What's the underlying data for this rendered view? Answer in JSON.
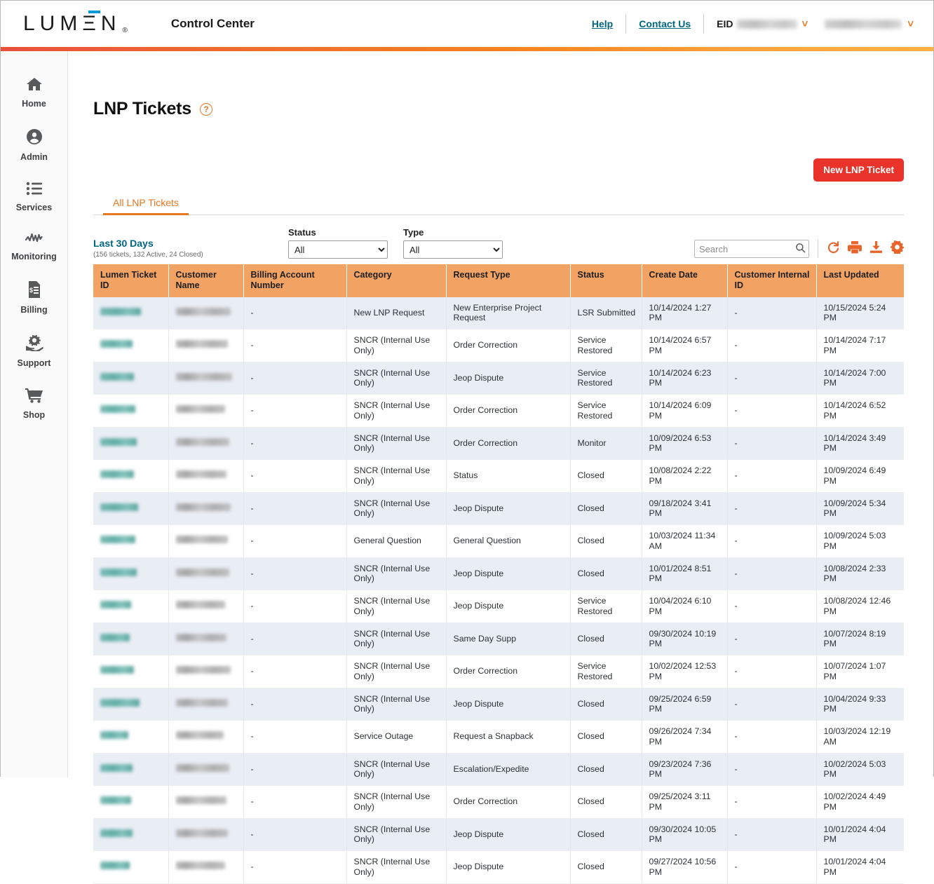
{
  "header": {
    "logo_text": "LUMΞN",
    "logo_registered": "®",
    "app_title": "Control Center",
    "help_label": "Help",
    "contact_label": "Contact Us",
    "eid_label": "EID",
    "eid_value_redacted": "",
    "account_value_redacted": "",
    "accent_color_left": "#e8503c",
    "accent_color_right": "#fbb040"
  },
  "sidebar": {
    "items": [
      {
        "label": "Home",
        "icon": "home-icon"
      },
      {
        "label": "Admin",
        "icon": "user-circle-icon"
      },
      {
        "label": "Services",
        "icon": "list-icon"
      },
      {
        "label": "Monitoring",
        "icon": "waveform-icon"
      },
      {
        "label": "Billing",
        "icon": "invoice-dollar-icon"
      },
      {
        "label": "Support",
        "icon": "hand-gear-icon"
      },
      {
        "label": "Shop",
        "icon": "shopping-cart-icon"
      }
    ]
  },
  "page": {
    "title": "LNP Tickets",
    "help_icon_glyph": "?",
    "new_ticket_button": "New LNP Ticket",
    "accent_orange": "#e87722",
    "button_red": "#e8322a"
  },
  "tabs": [
    {
      "label": "All LNP Tickets",
      "active": true
    }
  ],
  "filters": {
    "date_range_label": "Last 30 Days",
    "date_range_summary": "(156 tickets, 132 Active, 24 Closed)",
    "status": {
      "label": "Status",
      "value": "All",
      "options": [
        "All"
      ]
    },
    "type": {
      "label": "Type",
      "value": "All",
      "options": [
        "All"
      ]
    }
  },
  "search": {
    "placeholder": "Search",
    "value": "",
    "icon": "search-icon"
  },
  "toolbar_icons": [
    {
      "name": "refresh-icon"
    },
    {
      "name": "print-icon"
    },
    {
      "name": "download-icon"
    },
    {
      "name": "settings-gear-icon"
    }
  ],
  "table": {
    "columns": [
      "Lumen Ticket ID",
      "Customer Name",
      "Billing Account Number",
      "Category",
      "Request Type",
      "Status",
      "Create Date",
      "Customer Internal ID",
      "Last Updated"
    ],
    "rows": [
      {
        "ticket_id": "",
        "customer_name": "",
        "billing_account": "-",
        "category": "New LNP Request",
        "request_type": "New Enterprise Project Request",
        "status": "LSR Submitted",
        "create_date": "10/14/2024 1:27 PM",
        "internal_id": "-",
        "last_updated": "10/15/2024 5:24 PM"
      },
      {
        "ticket_id": "",
        "customer_name": "",
        "billing_account": "-",
        "category": "SNCR (Internal Use Only)",
        "request_type": "Order Correction",
        "status": "Service Restored",
        "create_date": "10/14/2024 6:57 PM",
        "internal_id": "-",
        "last_updated": "10/14/2024 7:17 PM"
      },
      {
        "ticket_id": "",
        "customer_name": "",
        "billing_account": "-",
        "category": "SNCR (Internal Use Only)",
        "request_type": "Jeop Dispute",
        "status": "Service Restored",
        "create_date": "10/14/2024 6:23 PM",
        "internal_id": "-",
        "last_updated": "10/14/2024 7:00 PM"
      },
      {
        "ticket_id": "",
        "customer_name": "",
        "billing_account": "-",
        "category": "SNCR (Internal Use Only)",
        "request_type": "Order Correction",
        "status": "Service Restored",
        "create_date": "10/14/2024 6:09 PM",
        "internal_id": "-",
        "last_updated": "10/14/2024 6:52 PM"
      },
      {
        "ticket_id": "",
        "customer_name": "",
        "billing_account": "-",
        "category": "SNCR (Internal Use Only)",
        "request_type": "Order Correction",
        "status": "Monitor",
        "create_date": "10/09/2024 6:53 PM",
        "internal_id": "-",
        "last_updated": "10/14/2024 3:49 PM"
      },
      {
        "ticket_id": "",
        "customer_name": "",
        "billing_account": "-",
        "category": "SNCR (Internal Use Only)",
        "request_type": "Status",
        "status": "Closed",
        "create_date": "10/08/2024 2:22 PM",
        "internal_id": "-",
        "last_updated": "10/09/2024 6:49 PM"
      },
      {
        "ticket_id": "",
        "customer_name": "",
        "billing_account": "-",
        "category": "SNCR (Internal Use Only)",
        "request_type": "Jeop Dispute",
        "status": "Closed",
        "create_date": "09/18/2024 3:41 PM",
        "internal_id": "-",
        "last_updated": "10/09/2024 5:34 PM"
      },
      {
        "ticket_id": "",
        "customer_name": "",
        "billing_account": "-",
        "category": "General Question",
        "request_type": "General Question",
        "status": "Closed",
        "create_date": "10/03/2024 11:34 AM",
        "internal_id": "-",
        "last_updated": "10/09/2024 5:03 PM"
      },
      {
        "ticket_id": "",
        "customer_name": "",
        "billing_account": "-",
        "category": "SNCR (Internal Use Only)",
        "request_type": "Jeop Dispute",
        "status": "Closed",
        "create_date": "10/01/2024 8:51 PM",
        "internal_id": "-",
        "last_updated": "10/08/2024 2:33 PM"
      },
      {
        "ticket_id": "",
        "customer_name": "",
        "billing_account": "-",
        "category": "SNCR (Internal Use Only)",
        "request_type": "Jeop Dispute",
        "status": "Service Restored",
        "create_date": "10/04/2024 6:10 PM",
        "internal_id": "-",
        "last_updated": "10/08/2024 12:46 PM"
      },
      {
        "ticket_id": "",
        "customer_name": "",
        "billing_account": "-",
        "category": "SNCR (Internal Use Only)",
        "request_type": "Same Day Supp",
        "status": "Closed",
        "create_date": "09/30/2024 10:19 PM",
        "internal_id": "-",
        "last_updated": "10/07/2024 8:19 PM"
      },
      {
        "ticket_id": "",
        "customer_name": "",
        "billing_account": "-",
        "category": "SNCR (Internal Use Only)",
        "request_type": "Order Correction",
        "status": "Service Restored",
        "create_date": "10/02/2024 12:53 PM",
        "internal_id": "-",
        "last_updated": "10/07/2024 1:07 PM"
      },
      {
        "ticket_id": "",
        "customer_name": "",
        "billing_account": "-",
        "category": "SNCR (Internal Use Only)",
        "request_type": "Jeop Dispute",
        "status": "Closed",
        "create_date": "09/25/2024 6:59 PM",
        "internal_id": "-",
        "last_updated": "10/04/2024 9:33 PM"
      },
      {
        "ticket_id": "",
        "customer_name": "",
        "billing_account": "-",
        "category": "Service Outage",
        "request_type": "Request a Snapback",
        "status": "Closed",
        "create_date": "09/26/2024 7:34 PM",
        "internal_id": "-",
        "last_updated": "10/03/2024 12:19 AM"
      },
      {
        "ticket_id": "",
        "customer_name": "",
        "billing_account": "-",
        "category": "SNCR (Internal Use Only)",
        "request_type": "Escalation/Expedite",
        "status": "Closed",
        "create_date": "09/23/2024 7:36 PM",
        "internal_id": "-",
        "last_updated": "10/02/2024 5:03 PM"
      },
      {
        "ticket_id": "",
        "customer_name": "",
        "billing_account": "-",
        "category": "SNCR (Internal Use Only)",
        "request_type": "Order Correction",
        "status": "Closed",
        "create_date": "09/25/2024 3:11 PM",
        "internal_id": "-",
        "last_updated": "10/02/2024 4:49 PM"
      },
      {
        "ticket_id": "",
        "customer_name": "",
        "billing_account": "-",
        "category": "SNCR (Internal Use Only)",
        "request_type": "Jeop Dispute",
        "status": "Closed",
        "create_date": "09/30/2024 10:05 PM",
        "internal_id": "-",
        "last_updated": "10/01/2024 4:04 PM"
      },
      {
        "ticket_id": "",
        "customer_name": "",
        "billing_account": "-",
        "category": "SNCR (Internal Use Only)",
        "request_type": "Jeop Dispute",
        "status": "Closed",
        "create_date": "09/27/2024 10:56 PM",
        "internal_id": "-",
        "last_updated": "10/01/2024 4:04 PM"
      }
    ]
  }
}
